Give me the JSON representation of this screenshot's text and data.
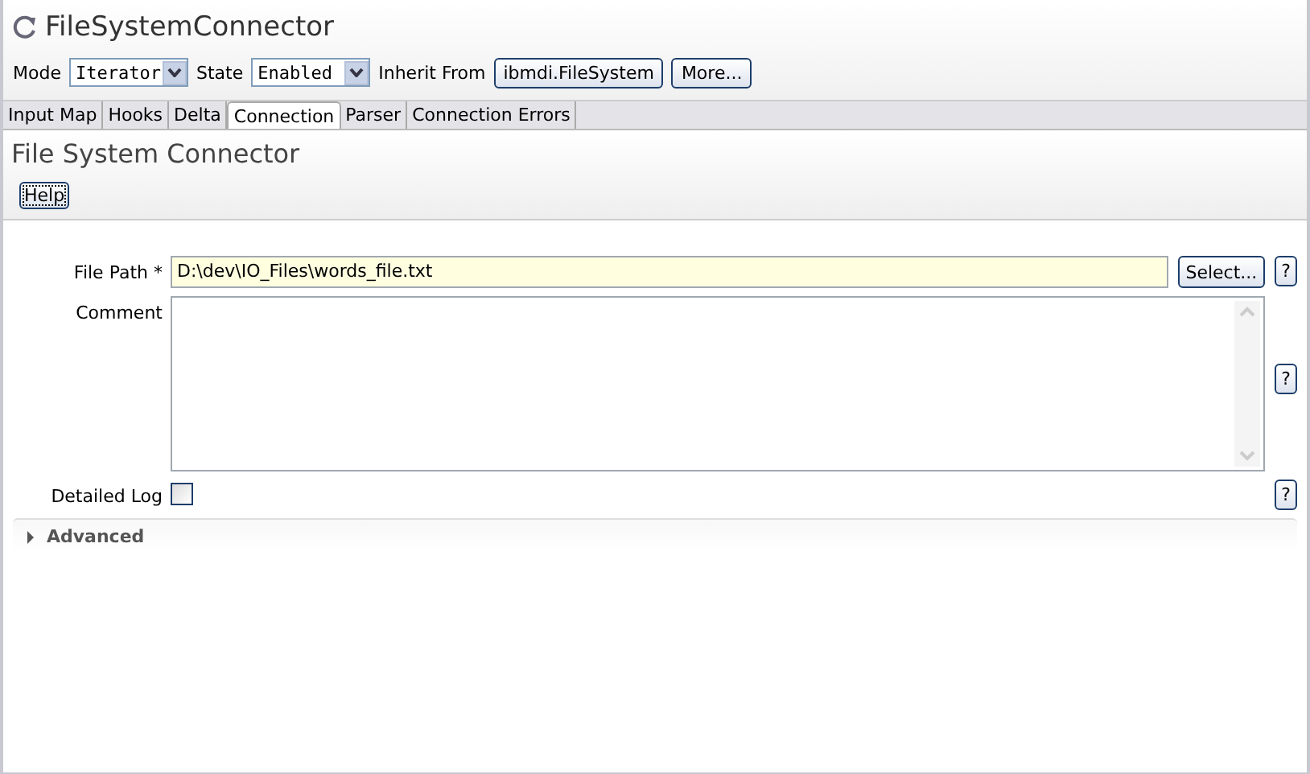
{
  "window": {
    "title": "FileSystemConnector"
  },
  "toolbar": {
    "mode": {
      "label": "Mode",
      "value": "Iterator"
    },
    "state": {
      "label": "State",
      "value": "Enabled"
    },
    "inherit_label": "Inherit From",
    "inherit_button": "ibmdi.FileSystem",
    "more_button": "More..."
  },
  "tabs": [
    {
      "label": "Input Map",
      "selected": false
    },
    {
      "label": "Hooks",
      "selected": false
    },
    {
      "label": "Delta",
      "selected": false
    },
    {
      "label": "Connection",
      "selected": true
    },
    {
      "label": "Parser",
      "selected": false
    },
    {
      "label": "Connection Errors",
      "selected": false
    }
  ],
  "section": {
    "title": "File System Connector",
    "help_button": "Help"
  },
  "fields": [
    {
      "kind": "text",
      "label": "File Path *",
      "value": "D:\\dev\\IO_Files\\words_file.txt",
      "button": "Select...",
      "help": "?"
    },
    {
      "kind": "textarea",
      "label": "Comment",
      "help": "?"
    },
    {
      "kind": "checkbox",
      "label": "Detailed Log",
      "checked": false,
      "help": "?"
    }
  ],
  "advanced": {
    "label": "Advanced",
    "expanded": false
  }
}
